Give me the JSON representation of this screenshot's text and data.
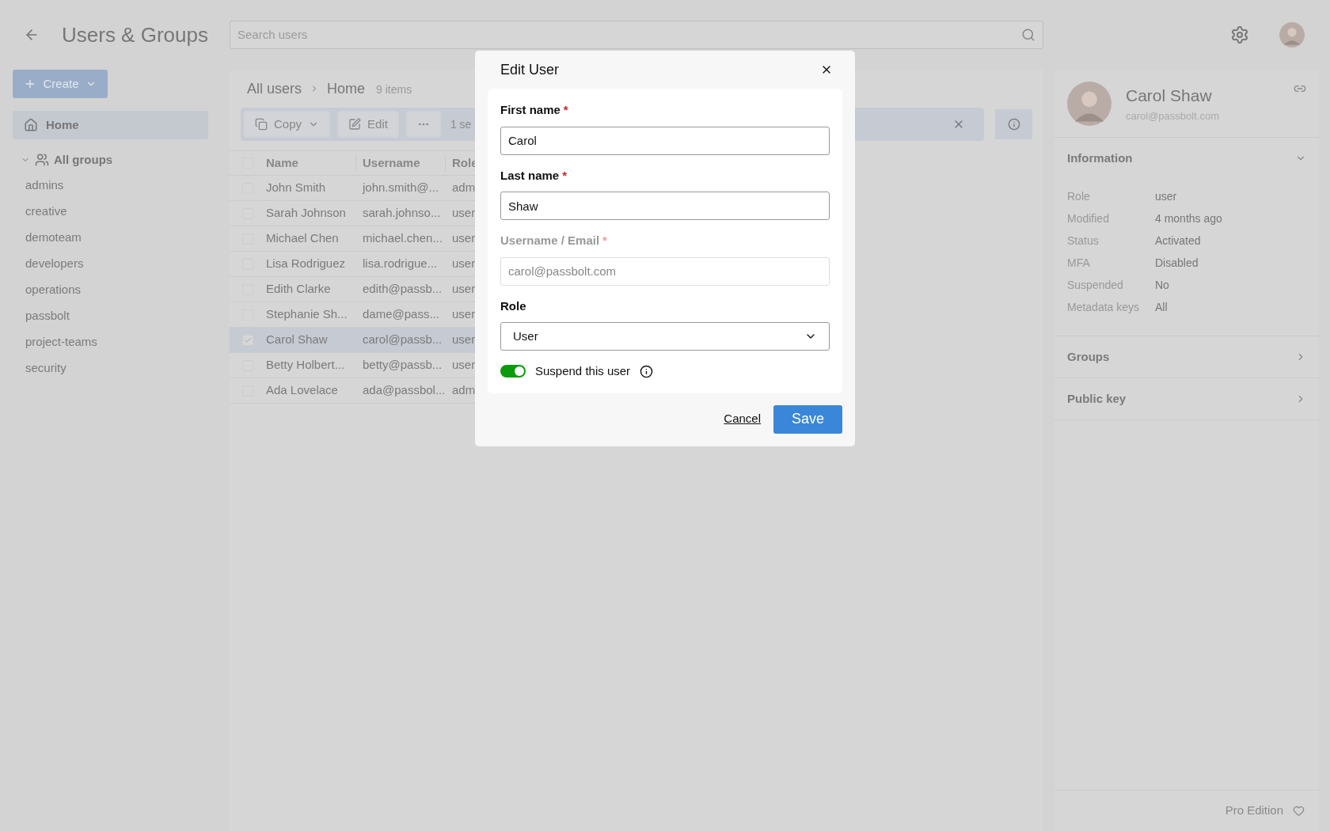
{
  "header": {
    "title": "Users & Groups",
    "search_placeholder": "Search users"
  },
  "sidebar": {
    "create_label": "Create",
    "items": [
      {
        "label": "Home",
        "selected": true
      }
    ],
    "groups_label": "All groups",
    "groups_expanded": true,
    "groups": [
      "admins",
      "creative",
      "demoteam",
      "developers",
      "operations",
      "passbolt",
      "project-teams",
      "security"
    ]
  },
  "breadcrumb": [
    "All users",
    "Home"
  ],
  "item_count": "9 items",
  "toolbar": {
    "buttons": [
      {
        "kind": "copy",
        "label": "Copy"
      },
      {
        "kind": "edit",
        "label": "Edit"
      },
      {
        "kind": "more"
      }
    ],
    "selection": "1 se"
  },
  "table": {
    "columns": [
      "Name",
      "Username",
      "Role"
    ],
    "all_selected": false,
    "rows": [
      {
        "name": "John Smith",
        "username": "john.smith@...",
        "role": "adm",
        "selected": false
      },
      {
        "name": "Sarah Johnson",
        "username": "sarah.johnso...",
        "role": "user",
        "selected": false
      },
      {
        "name": "Michael Chen",
        "username": "michael.chen...",
        "role": "user",
        "selected": false
      },
      {
        "name": "Lisa Rodriguez",
        "username": "lisa.rodrigue...",
        "role": "user",
        "selected": false
      },
      {
        "name": "Edith Clarke",
        "username": "edith@passb...",
        "role": "user",
        "selected": false
      },
      {
        "name": "Stephanie Sh...",
        "username": "dame@pass...",
        "role": "user",
        "selected": false
      },
      {
        "name": "Carol Shaw",
        "username": "carol@passb...",
        "role": "user",
        "selected": true
      },
      {
        "name": "Betty Holbert...",
        "username": "betty@passb...",
        "role": "user",
        "selected": false
      },
      {
        "name": "Ada Lovelace",
        "username": "ada@passbol...",
        "role": "adm",
        "selected": false
      }
    ]
  },
  "details": {
    "name": "Carol Shaw",
    "email": "carol@passbolt.com",
    "sections": [
      {
        "title": "Information",
        "expanded": true,
        "fields": [
          {
            "label": "Role",
            "value": "user"
          },
          {
            "label": "Modified",
            "value": "4 months ago"
          },
          {
            "label": "Status",
            "value": "Activated"
          },
          {
            "label": "MFA",
            "value": "Disabled"
          },
          {
            "label": "Suspended",
            "value": "No"
          },
          {
            "label": "Metadata keys",
            "value": "All"
          }
        ]
      },
      {
        "title": "Groups",
        "expanded": false
      },
      {
        "title": "Public key",
        "expanded": false
      }
    ],
    "footer": "Pro Edition"
  },
  "dialog": {
    "title": "Edit User",
    "fields": [
      {
        "kind": "text",
        "label": "First name",
        "required_mark": "*",
        "disabled": false,
        "value": "Carol"
      },
      {
        "kind": "text",
        "label": "Last name",
        "required_mark": "*",
        "disabled": false,
        "value": "Shaw"
      },
      {
        "kind": "text",
        "label": "Username / Email",
        "required_mark": "*",
        "disabled": true,
        "value": "carol@passbolt.com"
      },
      {
        "kind": "select",
        "label": "Role",
        "disabled": false,
        "value": "User"
      }
    ],
    "toggle": {
      "label": "Suspend this user",
      "on": true
    },
    "cancel": "Cancel",
    "save": "Save"
  }
}
